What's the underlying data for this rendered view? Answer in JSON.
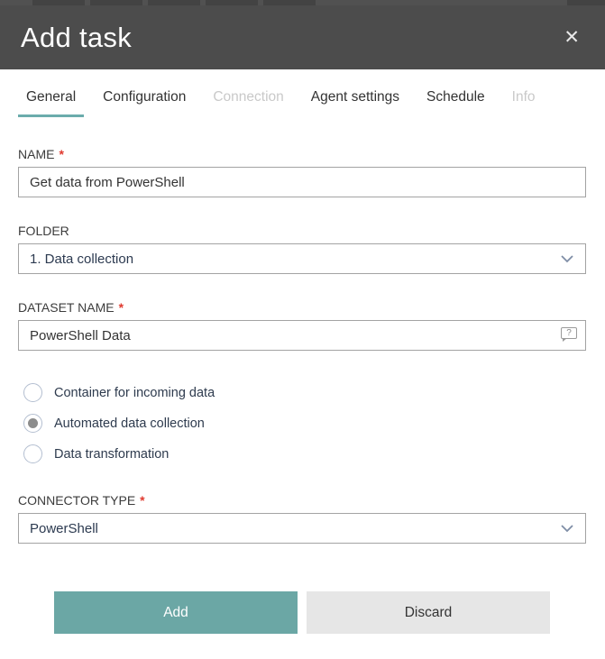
{
  "modal": {
    "title": "Add task",
    "close_icon_glyph": "✕",
    "tabs": [
      {
        "label": "General",
        "state": "active"
      },
      {
        "label": "Configuration",
        "state": "enabled"
      },
      {
        "label": "Connection",
        "state": "disabled"
      },
      {
        "label": "Agent settings",
        "state": "enabled"
      },
      {
        "label": "Schedule",
        "state": "enabled"
      },
      {
        "label": "Info",
        "state": "disabled"
      }
    ],
    "required_marker": "*",
    "fields": {
      "name": {
        "label": "NAME",
        "required": true,
        "value": "Get data from PowerShell"
      },
      "folder": {
        "label": "FOLDER",
        "required": false,
        "value": "1. Data collection"
      },
      "dataset_name": {
        "label": "DATASET NAME",
        "required": true,
        "value": "PowerShell Data",
        "help_glyph": "?"
      },
      "connector_type": {
        "label": "CONNECTOR TYPE",
        "required": true,
        "value": "PowerShell"
      }
    },
    "radios": [
      {
        "label": "Container for incoming data",
        "selected": false
      },
      {
        "label": "Automated data collection",
        "selected": true
      },
      {
        "label": "Data transformation",
        "selected": false
      }
    ],
    "buttons": {
      "add": "Add",
      "discard": "Discard"
    },
    "colors": {
      "accent_teal": "#6ba7a5",
      "header_bg": "#4c4c4c",
      "required_red": "#e03a2f",
      "disabled_tab": "#c9c9c9",
      "input_border": "#a3a3a3",
      "radio_border": "#b3bed0",
      "discard_bg": "#e6e6e6"
    }
  }
}
